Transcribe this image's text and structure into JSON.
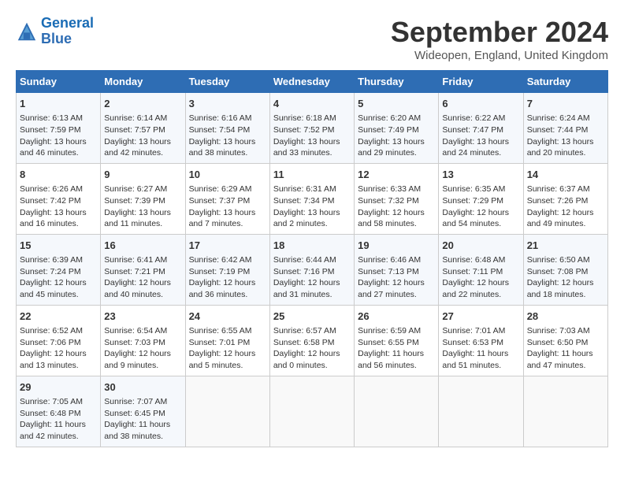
{
  "header": {
    "logo_line1": "General",
    "logo_line2": "Blue",
    "month": "September 2024",
    "location": "Wideopen, England, United Kingdom"
  },
  "columns": [
    "Sunday",
    "Monday",
    "Tuesday",
    "Wednesday",
    "Thursday",
    "Friday",
    "Saturday"
  ],
  "weeks": [
    [
      {
        "day": "1",
        "lines": [
          "Sunrise: 6:13 AM",
          "Sunset: 7:59 PM",
          "Daylight: 13 hours",
          "and 46 minutes."
        ]
      },
      {
        "day": "2",
        "lines": [
          "Sunrise: 6:14 AM",
          "Sunset: 7:57 PM",
          "Daylight: 13 hours",
          "and 42 minutes."
        ]
      },
      {
        "day": "3",
        "lines": [
          "Sunrise: 6:16 AM",
          "Sunset: 7:54 PM",
          "Daylight: 13 hours",
          "and 38 minutes."
        ]
      },
      {
        "day": "4",
        "lines": [
          "Sunrise: 6:18 AM",
          "Sunset: 7:52 PM",
          "Daylight: 13 hours",
          "and 33 minutes."
        ]
      },
      {
        "day": "5",
        "lines": [
          "Sunrise: 6:20 AM",
          "Sunset: 7:49 PM",
          "Daylight: 13 hours",
          "and 29 minutes."
        ]
      },
      {
        "day": "6",
        "lines": [
          "Sunrise: 6:22 AM",
          "Sunset: 7:47 PM",
          "Daylight: 13 hours",
          "and 24 minutes."
        ]
      },
      {
        "day": "7",
        "lines": [
          "Sunrise: 6:24 AM",
          "Sunset: 7:44 PM",
          "Daylight: 13 hours",
          "and 20 minutes."
        ]
      }
    ],
    [
      {
        "day": "8",
        "lines": [
          "Sunrise: 6:26 AM",
          "Sunset: 7:42 PM",
          "Daylight: 13 hours",
          "and 16 minutes."
        ]
      },
      {
        "day": "9",
        "lines": [
          "Sunrise: 6:27 AM",
          "Sunset: 7:39 PM",
          "Daylight: 13 hours",
          "and 11 minutes."
        ]
      },
      {
        "day": "10",
        "lines": [
          "Sunrise: 6:29 AM",
          "Sunset: 7:37 PM",
          "Daylight: 13 hours",
          "and 7 minutes."
        ]
      },
      {
        "day": "11",
        "lines": [
          "Sunrise: 6:31 AM",
          "Sunset: 7:34 PM",
          "Daylight: 13 hours",
          "and 2 minutes."
        ]
      },
      {
        "day": "12",
        "lines": [
          "Sunrise: 6:33 AM",
          "Sunset: 7:32 PM",
          "Daylight: 12 hours",
          "and 58 minutes."
        ]
      },
      {
        "day": "13",
        "lines": [
          "Sunrise: 6:35 AM",
          "Sunset: 7:29 PM",
          "Daylight: 12 hours",
          "and 54 minutes."
        ]
      },
      {
        "day": "14",
        "lines": [
          "Sunrise: 6:37 AM",
          "Sunset: 7:26 PM",
          "Daylight: 12 hours",
          "and 49 minutes."
        ]
      }
    ],
    [
      {
        "day": "15",
        "lines": [
          "Sunrise: 6:39 AM",
          "Sunset: 7:24 PM",
          "Daylight: 12 hours",
          "and 45 minutes."
        ]
      },
      {
        "day": "16",
        "lines": [
          "Sunrise: 6:41 AM",
          "Sunset: 7:21 PM",
          "Daylight: 12 hours",
          "and 40 minutes."
        ]
      },
      {
        "day": "17",
        "lines": [
          "Sunrise: 6:42 AM",
          "Sunset: 7:19 PM",
          "Daylight: 12 hours",
          "and 36 minutes."
        ]
      },
      {
        "day": "18",
        "lines": [
          "Sunrise: 6:44 AM",
          "Sunset: 7:16 PM",
          "Daylight: 12 hours",
          "and 31 minutes."
        ]
      },
      {
        "day": "19",
        "lines": [
          "Sunrise: 6:46 AM",
          "Sunset: 7:13 PM",
          "Daylight: 12 hours",
          "and 27 minutes."
        ]
      },
      {
        "day": "20",
        "lines": [
          "Sunrise: 6:48 AM",
          "Sunset: 7:11 PM",
          "Daylight: 12 hours",
          "and 22 minutes."
        ]
      },
      {
        "day": "21",
        "lines": [
          "Sunrise: 6:50 AM",
          "Sunset: 7:08 PM",
          "Daylight: 12 hours",
          "and 18 minutes."
        ]
      }
    ],
    [
      {
        "day": "22",
        "lines": [
          "Sunrise: 6:52 AM",
          "Sunset: 7:06 PM",
          "Daylight: 12 hours",
          "and 13 minutes."
        ]
      },
      {
        "day": "23",
        "lines": [
          "Sunrise: 6:54 AM",
          "Sunset: 7:03 PM",
          "Daylight: 12 hours",
          "and 9 minutes."
        ]
      },
      {
        "day": "24",
        "lines": [
          "Sunrise: 6:55 AM",
          "Sunset: 7:01 PM",
          "Daylight: 12 hours",
          "and 5 minutes."
        ]
      },
      {
        "day": "25",
        "lines": [
          "Sunrise: 6:57 AM",
          "Sunset: 6:58 PM",
          "Daylight: 12 hours",
          "and 0 minutes."
        ]
      },
      {
        "day": "26",
        "lines": [
          "Sunrise: 6:59 AM",
          "Sunset: 6:55 PM",
          "Daylight: 11 hours",
          "and 56 minutes."
        ]
      },
      {
        "day": "27",
        "lines": [
          "Sunrise: 7:01 AM",
          "Sunset: 6:53 PM",
          "Daylight: 11 hours",
          "and 51 minutes."
        ]
      },
      {
        "day": "28",
        "lines": [
          "Sunrise: 7:03 AM",
          "Sunset: 6:50 PM",
          "Daylight: 11 hours",
          "and 47 minutes."
        ]
      }
    ],
    [
      {
        "day": "29",
        "lines": [
          "Sunrise: 7:05 AM",
          "Sunset: 6:48 PM",
          "Daylight: 11 hours",
          "and 42 minutes."
        ]
      },
      {
        "day": "30",
        "lines": [
          "Sunrise: 7:07 AM",
          "Sunset: 6:45 PM",
          "Daylight: 11 hours",
          "and 38 minutes."
        ]
      },
      null,
      null,
      null,
      null,
      null
    ]
  ]
}
